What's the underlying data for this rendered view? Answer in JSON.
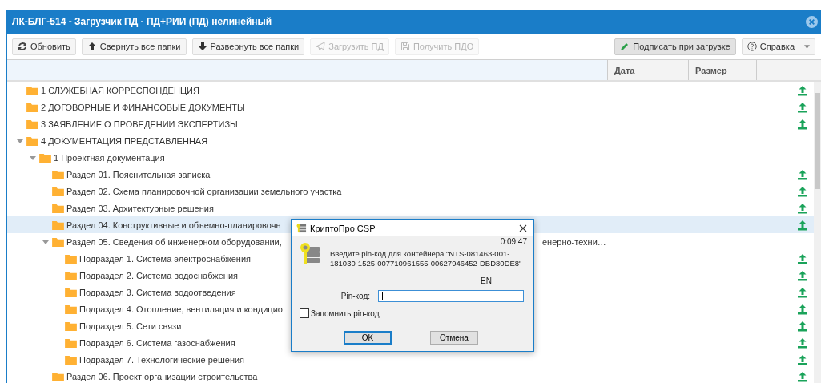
{
  "window": {
    "title": "ЛК-БЛГ-514 - Загрузчик ПД - ПД+РИИ (ПД) нелинейный"
  },
  "toolbar": {
    "left": [
      {
        "label": "Обновить",
        "kind": "refresh",
        "disabled": false
      },
      {
        "label": "Свернуть все папки",
        "kind": "collapse",
        "disabled": false
      },
      {
        "label": "Развернуть все папки",
        "kind": "expand",
        "disabled": false
      },
      {
        "label": "Загрузить ПД",
        "kind": "send",
        "disabled": true
      },
      {
        "label": "Получить ПДО",
        "kind": "save",
        "disabled": true
      }
    ],
    "right": [
      {
        "label": "Подписать при загрузке",
        "kind": "sign",
        "pressed": true
      },
      {
        "label": "Справка",
        "kind": "help",
        "pressed": false
      }
    ]
  },
  "table": {
    "columns": [
      "Дата",
      "Размер"
    ],
    "tree": [
      {
        "label": "1 СЛУЖЕБНАЯ КОРРЕСПОНДЕНЦИЯ",
        "upload": true,
        "selected": false
      },
      {
        "label": "2 ДОГОВОРНЫЕ И ФИНАНСОВЫЕ ДОКУМЕНТЫ",
        "upload": true,
        "selected": false
      },
      {
        "label": "3 ЗАЯВЛЕНИЕ О ПРОВЕДЕНИИ ЭКСПЕРТИЗЫ",
        "upload": true,
        "selected": false
      },
      {
        "label": "4 ДОКУМЕНТАЦИЯ ПРЕДСТАВЛЕННАЯ",
        "upload": false,
        "selected": false,
        "expanded": true,
        "children": [
          {
            "label": "1 Проектная документация",
            "upload": false,
            "selected": false,
            "expanded": true,
            "children": [
              {
                "label": "Раздел 01. Пояснительная записка",
                "upload": true,
                "selected": false
              },
              {
                "label": "Раздел 02. Схема планировочной организации земельного участка",
                "upload": true,
                "selected": false
              },
              {
                "label": "Раздел 03. Архитектурные решения",
                "upload": true,
                "selected": false
              },
              {
                "label": "Раздел 04. Конструктивные и объемно-планировочн",
                "upload": true,
                "selected": true
              },
              {
                "label": "Раздел 05. Сведения об инженерном оборудовании,",
                "tail": "енерно-техни…",
                "upload": false,
                "selected": false,
                "expanded": true,
                "children": [
                  {
                    "label": "Подраздел 1. Система электроснабжения",
                    "upload": true,
                    "selected": false
                  },
                  {
                    "label": "Подраздел 2. Система водоснабжения",
                    "upload": true,
                    "selected": false
                  },
                  {
                    "label": "Подраздел 3. Система водоотведения",
                    "upload": true,
                    "selected": false
                  },
                  {
                    "label": "Подраздел 4. Отопление, вентиляция и кондицио",
                    "upload": true,
                    "selected": false
                  },
                  {
                    "label": "Подраздел 5. Сети связи",
                    "upload": true,
                    "selected": false
                  },
                  {
                    "label": "Подраздел 6. Система газоснабжения",
                    "upload": true,
                    "selected": false
                  },
                  {
                    "label": "Подраздел 7. Технологические решения",
                    "upload": true,
                    "selected": false
                  }
                ]
              },
              {
                "label": "Раздел 06. Проект организации строительства",
                "upload": true,
                "selected": false
              }
            ]
          }
        ]
      }
    ]
  },
  "dialog": {
    "title": "КриптоПро CSP",
    "timer": "0:09:47",
    "message": "Введите pin-код для контейнера \"NTS-081463-001-181030-1525-007710961555-00627946452-DBD80DE8\"",
    "layout": "EN",
    "field_label": "Pin-код:",
    "remember": {
      "label": "Запомнить pin-код",
      "checked": false
    },
    "buttons": [
      {
        "label": "OK",
        "default": true
      },
      {
        "label": "Отмена",
        "default": false
      }
    ]
  }
}
